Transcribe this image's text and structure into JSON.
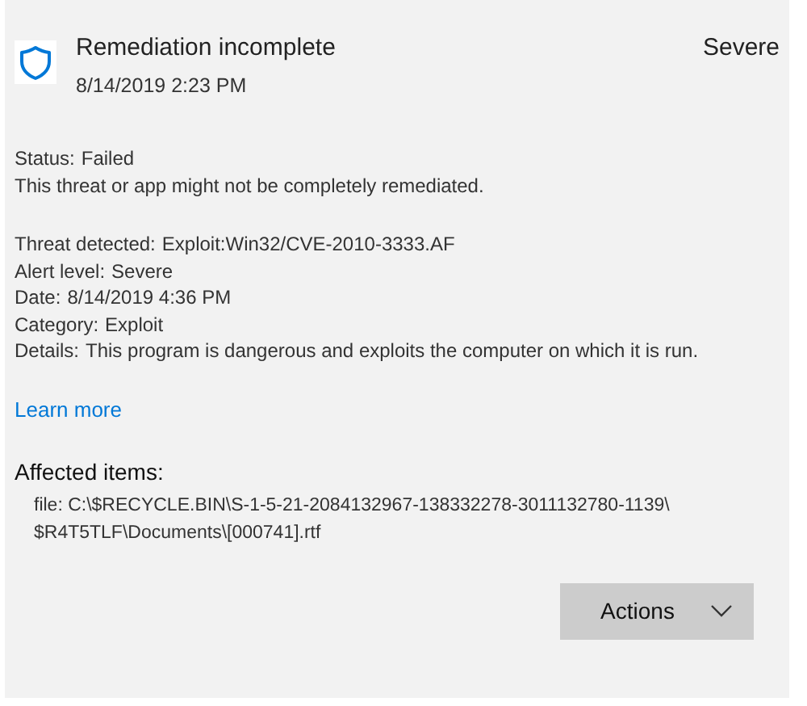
{
  "header": {
    "title": "Remediation incomplete",
    "date": "8/14/2019 2:23 PM",
    "severity": "Severe"
  },
  "status": {
    "label": "Status:",
    "value": "Failed",
    "message": "This threat or app might not be completely remediated."
  },
  "details": [
    {
      "label": "Threat detected:",
      "value": "Exploit:Win32/CVE-2010-3333.AF"
    },
    {
      "label": "Alert level:",
      "value": "Severe"
    },
    {
      "label": "Date:",
      "value": "8/14/2019 4:36 PM"
    },
    {
      "label": "Category:",
      "value": "Exploit"
    },
    {
      "label": "Details:",
      "value": "This program is dangerous and exploits the computer on which it is run."
    }
  ],
  "learn_more": "Learn more",
  "affected_items": {
    "heading": "Affected items:",
    "items": [
      "file: C:\\$RECYCLE.BIN\\S-1-5-21-2084132967-138332278-3011132780-1139\\",
      "$R4T5TLF\\Documents\\[000741].rtf"
    ]
  },
  "actions_button": "Actions"
}
